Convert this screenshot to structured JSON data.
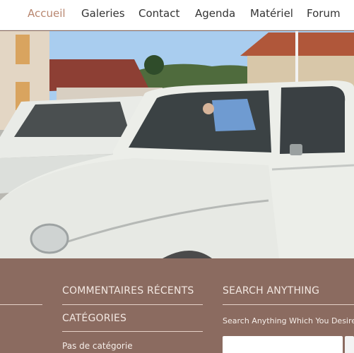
{
  "nav": {
    "items": [
      {
        "label": "Accueil",
        "active": true
      },
      {
        "label": "Galeries",
        "active": false
      },
      {
        "label": "Contact",
        "active": false
      },
      {
        "label": "Agenda",
        "active": false
      },
      {
        "label": "Matériel",
        "active": false
      },
      {
        "label": "Forum",
        "active": false
      }
    ]
  },
  "colors": {
    "accent": "#b8866f",
    "footer_bg": "#8b6b60",
    "footer_text": "#f3e8e2"
  },
  "widgets": {
    "recent_comments_title": "COMMENTAIRES RÉCENTS",
    "categories_title": "CATÉGORIES",
    "categories_item": "Pas de catégorie",
    "search_title": "SEARCH ANYTHING",
    "search_caption": "Search Anything Which You Desire."
  }
}
